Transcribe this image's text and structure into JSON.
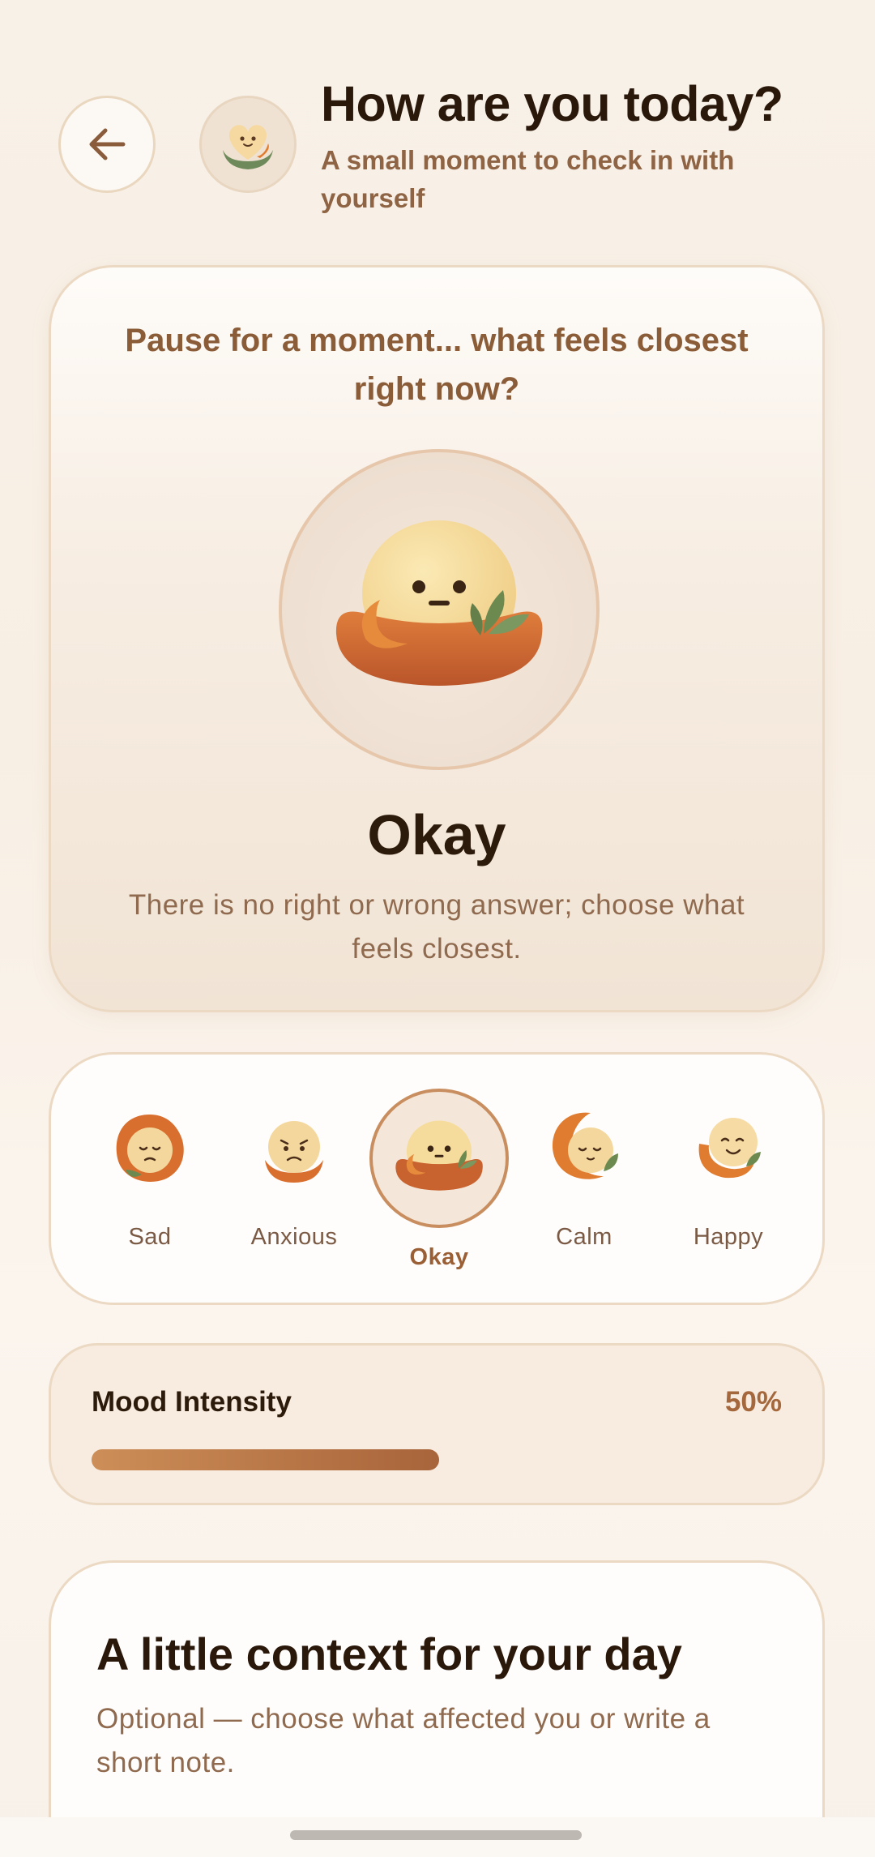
{
  "header": {
    "back_icon": "arrow-left-icon",
    "avatar_icon": "heart-face-icon",
    "title": "How are you today?",
    "subtitle": "A small moment to check in with yourself"
  },
  "mood_card": {
    "prompt": "Pause for a moment... what feels closest right now?",
    "hero_icon": "okay-face-icon",
    "selected_mood": "Okay",
    "hint": "There is no right or wrong answer; choose what feels closest."
  },
  "mood_options": [
    {
      "label": "Sad",
      "icon": "sad-face-icon"
    },
    {
      "label": "Anxious",
      "icon": "anxious-face-icon"
    },
    {
      "label": "Okay",
      "icon": "okay-face-icon",
      "selected": true
    },
    {
      "label": "Calm",
      "icon": "calm-face-icon"
    },
    {
      "label": "Happy",
      "icon": "happy-face-icon"
    }
  ],
  "intensity": {
    "title": "Mood Intensity",
    "value_label": "50%",
    "value": 0.5
  },
  "context": {
    "title": "A little context for your day",
    "subtitle": "Optional — choose what affected you or write a short note."
  },
  "colors": {
    "accent": "#a8643a",
    "accent_light": "#cd8e58",
    "background": "#f8f1e8",
    "title_text": "#2a180a",
    "muted_text": "#8f6a4f"
  }
}
